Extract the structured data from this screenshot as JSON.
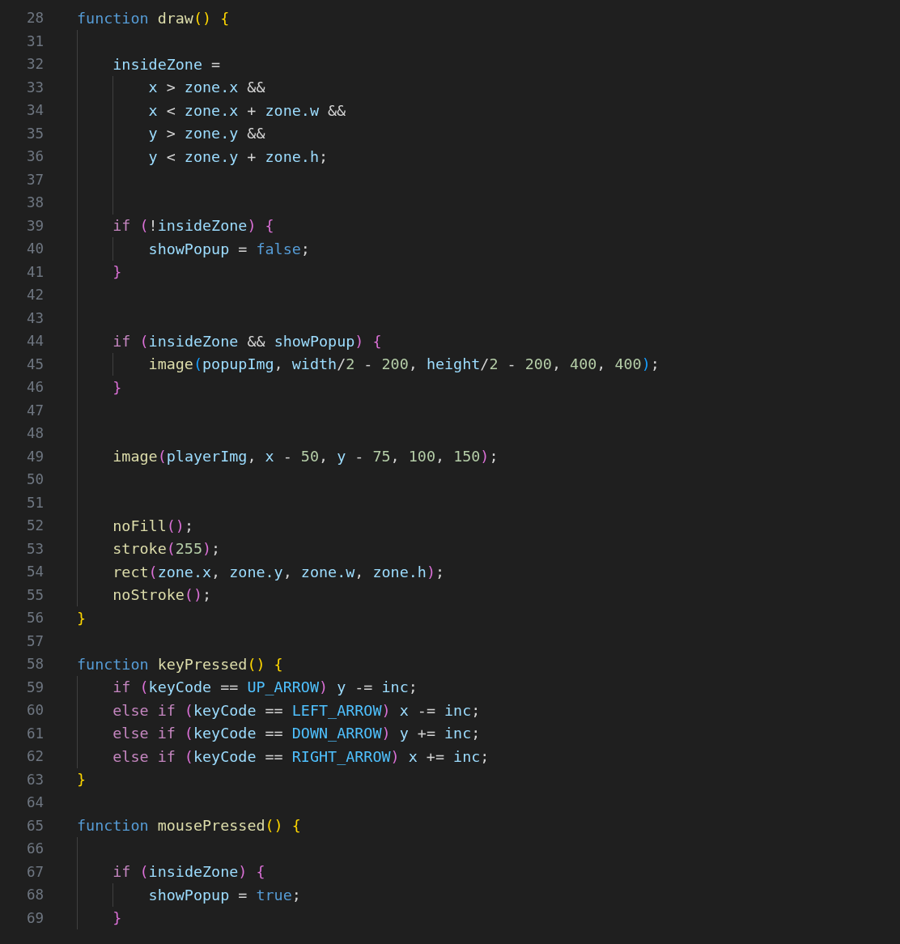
{
  "editor": {
    "lines": [
      {
        "number": "28",
        "tokens": [
          {
            "text": "function ",
            "kind": "keyword"
          },
          {
            "text": "draw",
            "kind": "function"
          },
          {
            "text": "()",
            "kind": "bracket1"
          },
          {
            "text": " {",
            "kind": "bracket1"
          }
        ]
      },
      {
        "number": "31"
      },
      {
        "number": "32",
        "tokens": [
          {
            "text": "    insideZone",
            "kind": "variable"
          },
          {
            "text": " =",
            "kind": "plain"
          }
        ]
      },
      {
        "number": "33",
        "tokens": [
          {
            "text": "        x",
            "kind": "variable"
          },
          {
            "text": " > ",
            "kind": "plain"
          },
          {
            "text": "zone.x",
            "kind": "variable"
          },
          {
            "text": " &&",
            "kind": "plain"
          }
        ]
      },
      {
        "number": "34",
        "tokens": [
          {
            "text": "        x",
            "kind": "variable"
          },
          {
            "text": " < ",
            "kind": "plain"
          },
          {
            "text": "zone.x",
            "kind": "variable"
          },
          {
            "text": " + ",
            "kind": "plain"
          },
          {
            "text": "zone.w",
            "kind": "variable"
          },
          {
            "text": " &&",
            "kind": "plain"
          }
        ]
      },
      {
        "number": "35",
        "tokens": [
          {
            "text": "        y",
            "kind": "variable"
          },
          {
            "text": " > ",
            "kind": "plain"
          },
          {
            "text": "zone.y",
            "kind": "variable"
          },
          {
            "text": " &&",
            "kind": "plain"
          }
        ]
      },
      {
        "number": "36",
        "tokens": [
          {
            "text": "        y",
            "kind": "variable"
          },
          {
            "text": " < ",
            "kind": "plain"
          },
          {
            "text": "zone.y",
            "kind": "variable"
          },
          {
            "text": " + ",
            "kind": "plain"
          },
          {
            "text": "zone.h",
            "kind": "variable"
          },
          {
            "text": ";",
            "kind": "plain"
          }
        ]
      },
      {
        "number": "37"
      },
      {
        "number": "38"
      },
      {
        "number": "39",
        "tokens": [
          {
            "text": "    if",
            "kind": "control"
          },
          {
            "text": " (",
            "kind": "bracket2"
          },
          {
            "text": "!",
            "kind": "plain"
          },
          {
            "text": "insideZone",
            "kind": "variable"
          },
          {
            "text": ")",
            "kind": "bracket2"
          },
          {
            "text": " {",
            "kind": "bracket2"
          }
        ]
      },
      {
        "number": "40",
        "tokens": [
          {
            "text": "        showPopup",
            "kind": "variable"
          },
          {
            "text": " = ",
            "kind": "plain"
          },
          {
            "text": "false",
            "kind": "boolean"
          },
          {
            "text": ";",
            "kind": "plain"
          }
        ]
      },
      {
        "number": "41",
        "tokens": [
          {
            "text": "    }",
            "kind": "bracket2"
          }
        ]
      },
      {
        "number": "42"
      },
      {
        "number": "43"
      },
      {
        "number": "44",
        "tokens": [
          {
            "text": "    if",
            "kind": "control"
          },
          {
            "text": " (",
            "kind": "bracket2"
          },
          {
            "text": "insideZone",
            "kind": "variable"
          },
          {
            "text": " && ",
            "kind": "plain"
          },
          {
            "text": "showPopup",
            "kind": "variable"
          },
          {
            "text": ")",
            "kind": "bracket2"
          },
          {
            "text": " {",
            "kind": "bracket2"
          }
        ]
      },
      {
        "number": "45",
        "tokens": [
          {
            "text": "        image",
            "kind": "function"
          },
          {
            "text": "(",
            "kind": "bracket3"
          },
          {
            "text": "popupImg",
            "kind": "variable"
          },
          {
            "text": ", ",
            "kind": "plain"
          },
          {
            "text": "width",
            "kind": "variable"
          },
          {
            "text": "/",
            "kind": "plain"
          },
          {
            "text": "2",
            "kind": "number"
          },
          {
            "text": " - ",
            "kind": "plain"
          },
          {
            "text": "200",
            "kind": "number"
          },
          {
            "text": ", ",
            "kind": "plain"
          },
          {
            "text": "height",
            "kind": "variable"
          },
          {
            "text": "/",
            "kind": "plain"
          },
          {
            "text": "2",
            "kind": "number"
          },
          {
            "text": " - ",
            "kind": "plain"
          },
          {
            "text": "200",
            "kind": "number"
          },
          {
            "text": ", ",
            "kind": "plain"
          },
          {
            "text": "400",
            "kind": "number"
          },
          {
            "text": ", ",
            "kind": "plain"
          },
          {
            "text": "400",
            "kind": "number"
          },
          {
            "text": ")",
            "kind": "bracket3"
          },
          {
            "text": ";",
            "kind": "plain"
          }
        ]
      },
      {
        "number": "46",
        "tokens": [
          {
            "text": "    }",
            "kind": "bracket2"
          }
        ]
      },
      {
        "number": "47"
      },
      {
        "number": "48"
      },
      {
        "number": "49",
        "tokens": [
          {
            "text": "    image",
            "kind": "function"
          },
          {
            "text": "(",
            "kind": "bracket2"
          },
          {
            "text": "playerImg",
            "kind": "variable"
          },
          {
            "text": ", ",
            "kind": "plain"
          },
          {
            "text": "x",
            "kind": "variable"
          },
          {
            "text": " - ",
            "kind": "plain"
          },
          {
            "text": "50",
            "kind": "number"
          },
          {
            "text": ", ",
            "kind": "plain"
          },
          {
            "text": "y",
            "kind": "variable"
          },
          {
            "text": " - ",
            "kind": "plain"
          },
          {
            "text": "75",
            "kind": "number"
          },
          {
            "text": ", ",
            "kind": "plain"
          },
          {
            "text": "100",
            "kind": "number"
          },
          {
            "text": ", ",
            "kind": "plain"
          },
          {
            "text": "150",
            "kind": "number"
          },
          {
            "text": ")",
            "kind": "bracket2"
          },
          {
            "text": ";",
            "kind": "plain"
          }
        ]
      },
      {
        "number": "50"
      },
      {
        "number": "51"
      },
      {
        "number": "52",
        "tokens": [
          {
            "text": "    noFill",
            "kind": "function"
          },
          {
            "text": "()",
            "kind": "bracket2"
          },
          {
            "text": ";",
            "kind": "plain"
          }
        ]
      },
      {
        "number": "53",
        "tokens": [
          {
            "text": "    stroke",
            "kind": "function"
          },
          {
            "text": "(",
            "kind": "bracket2"
          },
          {
            "text": "255",
            "kind": "number"
          },
          {
            "text": ")",
            "kind": "bracket2"
          },
          {
            "text": ";",
            "kind": "plain"
          }
        ]
      },
      {
        "number": "54",
        "tokens": [
          {
            "text": "    rect",
            "kind": "function"
          },
          {
            "text": "(",
            "kind": "bracket2"
          },
          {
            "text": "zone.x",
            "kind": "variable"
          },
          {
            "text": ", ",
            "kind": "plain"
          },
          {
            "text": "zone.y",
            "kind": "variable"
          },
          {
            "text": ", ",
            "kind": "plain"
          },
          {
            "text": "zone.w",
            "kind": "variable"
          },
          {
            "text": ", ",
            "kind": "plain"
          },
          {
            "text": "zone.h",
            "kind": "variable"
          },
          {
            "text": ")",
            "kind": "bracket2"
          },
          {
            "text": ";",
            "kind": "plain"
          }
        ]
      },
      {
        "number": "55",
        "tokens": [
          {
            "text": "    noStroke",
            "kind": "function"
          },
          {
            "text": "()",
            "kind": "bracket2"
          },
          {
            "text": ";",
            "kind": "plain"
          }
        ]
      },
      {
        "number": "56",
        "tokens": [
          {
            "text": "}",
            "kind": "bracket1"
          }
        ]
      },
      {
        "number": "57"
      },
      {
        "number": "58",
        "tokens": [
          {
            "text": "function ",
            "kind": "keyword"
          },
          {
            "text": "keyPressed",
            "kind": "function"
          },
          {
            "text": "()",
            "kind": "bracket1"
          },
          {
            "text": " {",
            "kind": "bracket1"
          }
        ]
      },
      {
        "number": "59",
        "tokens": [
          {
            "text": "    if",
            "kind": "control"
          },
          {
            "text": " (",
            "kind": "bracket2"
          },
          {
            "text": "keyCode",
            "kind": "variable"
          },
          {
            "text": " == ",
            "kind": "plain"
          },
          {
            "text": "UP_ARROW",
            "kind": "constant"
          },
          {
            "text": ")",
            "kind": "bracket2"
          },
          {
            "text": " y",
            "kind": "variable"
          },
          {
            "text": " -= ",
            "kind": "plain"
          },
          {
            "text": "inc",
            "kind": "variable"
          },
          {
            "text": ";",
            "kind": "plain"
          }
        ]
      },
      {
        "number": "60",
        "tokens": [
          {
            "text": "    else if",
            "kind": "control"
          },
          {
            "text": " (",
            "kind": "bracket2"
          },
          {
            "text": "keyCode",
            "kind": "variable"
          },
          {
            "text": " == ",
            "kind": "plain"
          },
          {
            "text": "LEFT_ARROW",
            "kind": "constant"
          },
          {
            "text": ")",
            "kind": "bracket2"
          },
          {
            "text": " x",
            "kind": "variable"
          },
          {
            "text": " -= ",
            "kind": "plain"
          },
          {
            "text": "inc",
            "kind": "variable"
          },
          {
            "text": ";",
            "kind": "plain"
          }
        ]
      },
      {
        "number": "61",
        "tokens": [
          {
            "text": "    else if",
            "kind": "control"
          },
          {
            "text": " (",
            "kind": "bracket2"
          },
          {
            "text": "keyCode",
            "kind": "variable"
          },
          {
            "text": " == ",
            "kind": "plain"
          },
          {
            "text": "DOWN_ARROW",
            "kind": "constant"
          },
          {
            "text": ")",
            "kind": "bracket2"
          },
          {
            "text": " y",
            "kind": "variable"
          },
          {
            "text": " += ",
            "kind": "plain"
          },
          {
            "text": "inc",
            "kind": "variable"
          },
          {
            "text": ";",
            "kind": "plain"
          }
        ]
      },
      {
        "number": "62",
        "tokens": [
          {
            "text": "    else if",
            "kind": "control"
          },
          {
            "text": " (",
            "kind": "bracket2"
          },
          {
            "text": "keyCode",
            "kind": "variable"
          },
          {
            "text": " == ",
            "kind": "plain"
          },
          {
            "text": "RIGHT_ARROW",
            "kind": "constant"
          },
          {
            "text": ")",
            "kind": "bracket2"
          },
          {
            "text": " x",
            "kind": "variable"
          },
          {
            "text": " += ",
            "kind": "plain"
          },
          {
            "text": "inc",
            "kind": "variable"
          },
          {
            "text": ";",
            "kind": "plain"
          }
        ]
      },
      {
        "number": "63",
        "tokens": [
          {
            "text": "}",
            "kind": "bracket1"
          }
        ]
      },
      {
        "number": "64"
      },
      {
        "number": "65",
        "tokens": [
          {
            "text": "function ",
            "kind": "keyword"
          },
          {
            "text": "mousePressed",
            "kind": "function"
          },
          {
            "text": "()",
            "kind": "bracket1"
          },
          {
            "text": " {",
            "kind": "bracket1"
          }
        ]
      },
      {
        "number": "66"
      },
      {
        "number": "67",
        "tokens": [
          {
            "text": "    if",
            "kind": "control"
          },
          {
            "text": " (",
            "kind": "bracket2"
          },
          {
            "text": "insideZone",
            "kind": "variable"
          },
          {
            "text": ")",
            "kind": "bracket2"
          },
          {
            "text": " {",
            "kind": "bracket2"
          }
        ]
      },
      {
        "number": "68",
        "tokens": [
          {
            "text": "        showPopup",
            "kind": "variable"
          },
          {
            "text": " = ",
            "kind": "plain"
          },
          {
            "text": "true",
            "kind": "boolean"
          },
          {
            "text": ";",
            "kind": "plain"
          }
        ]
      },
      {
        "number": "69",
        "tokens": [
          {
            "text": "    }",
            "kind": "bracket2"
          }
        ]
      }
    ]
  }
}
